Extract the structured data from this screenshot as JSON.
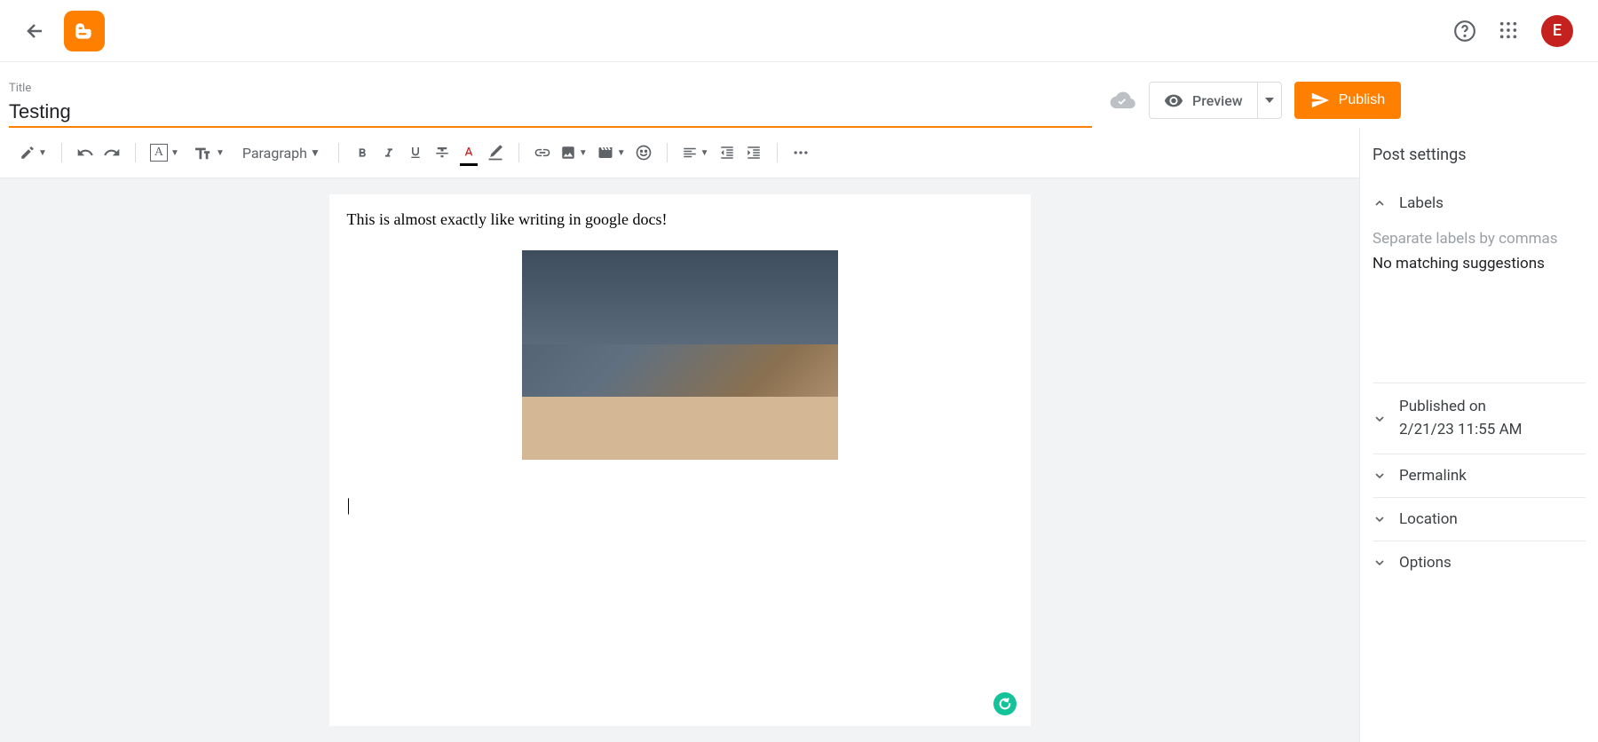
{
  "header": {
    "avatar_initial": "E"
  },
  "title": {
    "label": "Title",
    "value": "Testing"
  },
  "actions": {
    "preview_label": "Preview",
    "publish_label": "Publish"
  },
  "toolbar": {
    "paragraph_label": "Paragraph"
  },
  "document": {
    "text_line": "This is almost exactly like writing in google docs!",
    "cursor": "|"
  },
  "sidebar": {
    "title": "Post settings",
    "labels": {
      "heading": "Labels",
      "placeholder": "Separate labels by commas",
      "suggestion": "No matching suggestions"
    },
    "published": {
      "line1": "Published on",
      "line2": "2/21/23 11:55 AM"
    },
    "permalink": "Permalink",
    "location": "Location",
    "options": "Options"
  }
}
